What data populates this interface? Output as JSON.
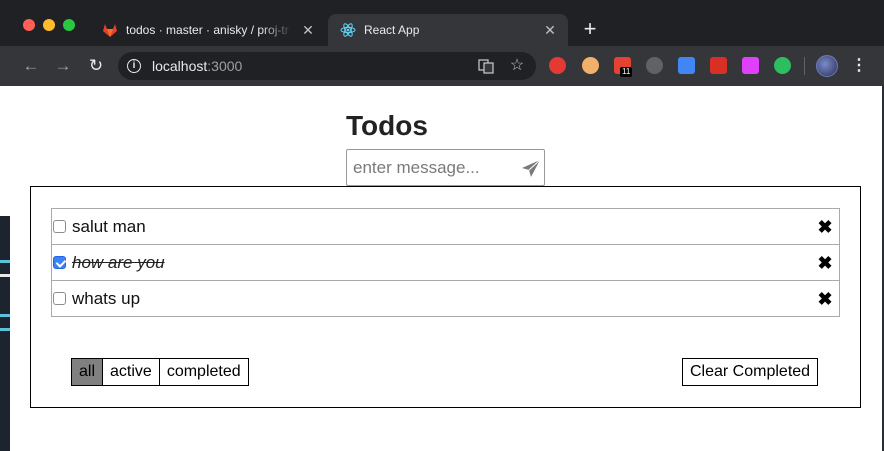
{
  "browser": {
    "tabs": [
      {
        "title": "todos · master · anisky / proj-tr",
        "icon": "gitlab-icon",
        "active": false
      },
      {
        "title": "React App",
        "icon": "react-icon",
        "active": true
      }
    ],
    "address": {
      "host": "localhost",
      "port": ":3000"
    },
    "extensions_badge": "11"
  },
  "app": {
    "title": "Todos",
    "message_placeholder": "enter message...",
    "todos": [
      {
        "text": "salut man",
        "completed": false
      },
      {
        "text": "how are you",
        "completed": true
      },
      {
        "text": "whats up",
        "completed": false
      }
    ],
    "filters": [
      "all",
      "active",
      "completed"
    ],
    "active_filter": "all",
    "clear_completed_label": "Clear Completed"
  }
}
